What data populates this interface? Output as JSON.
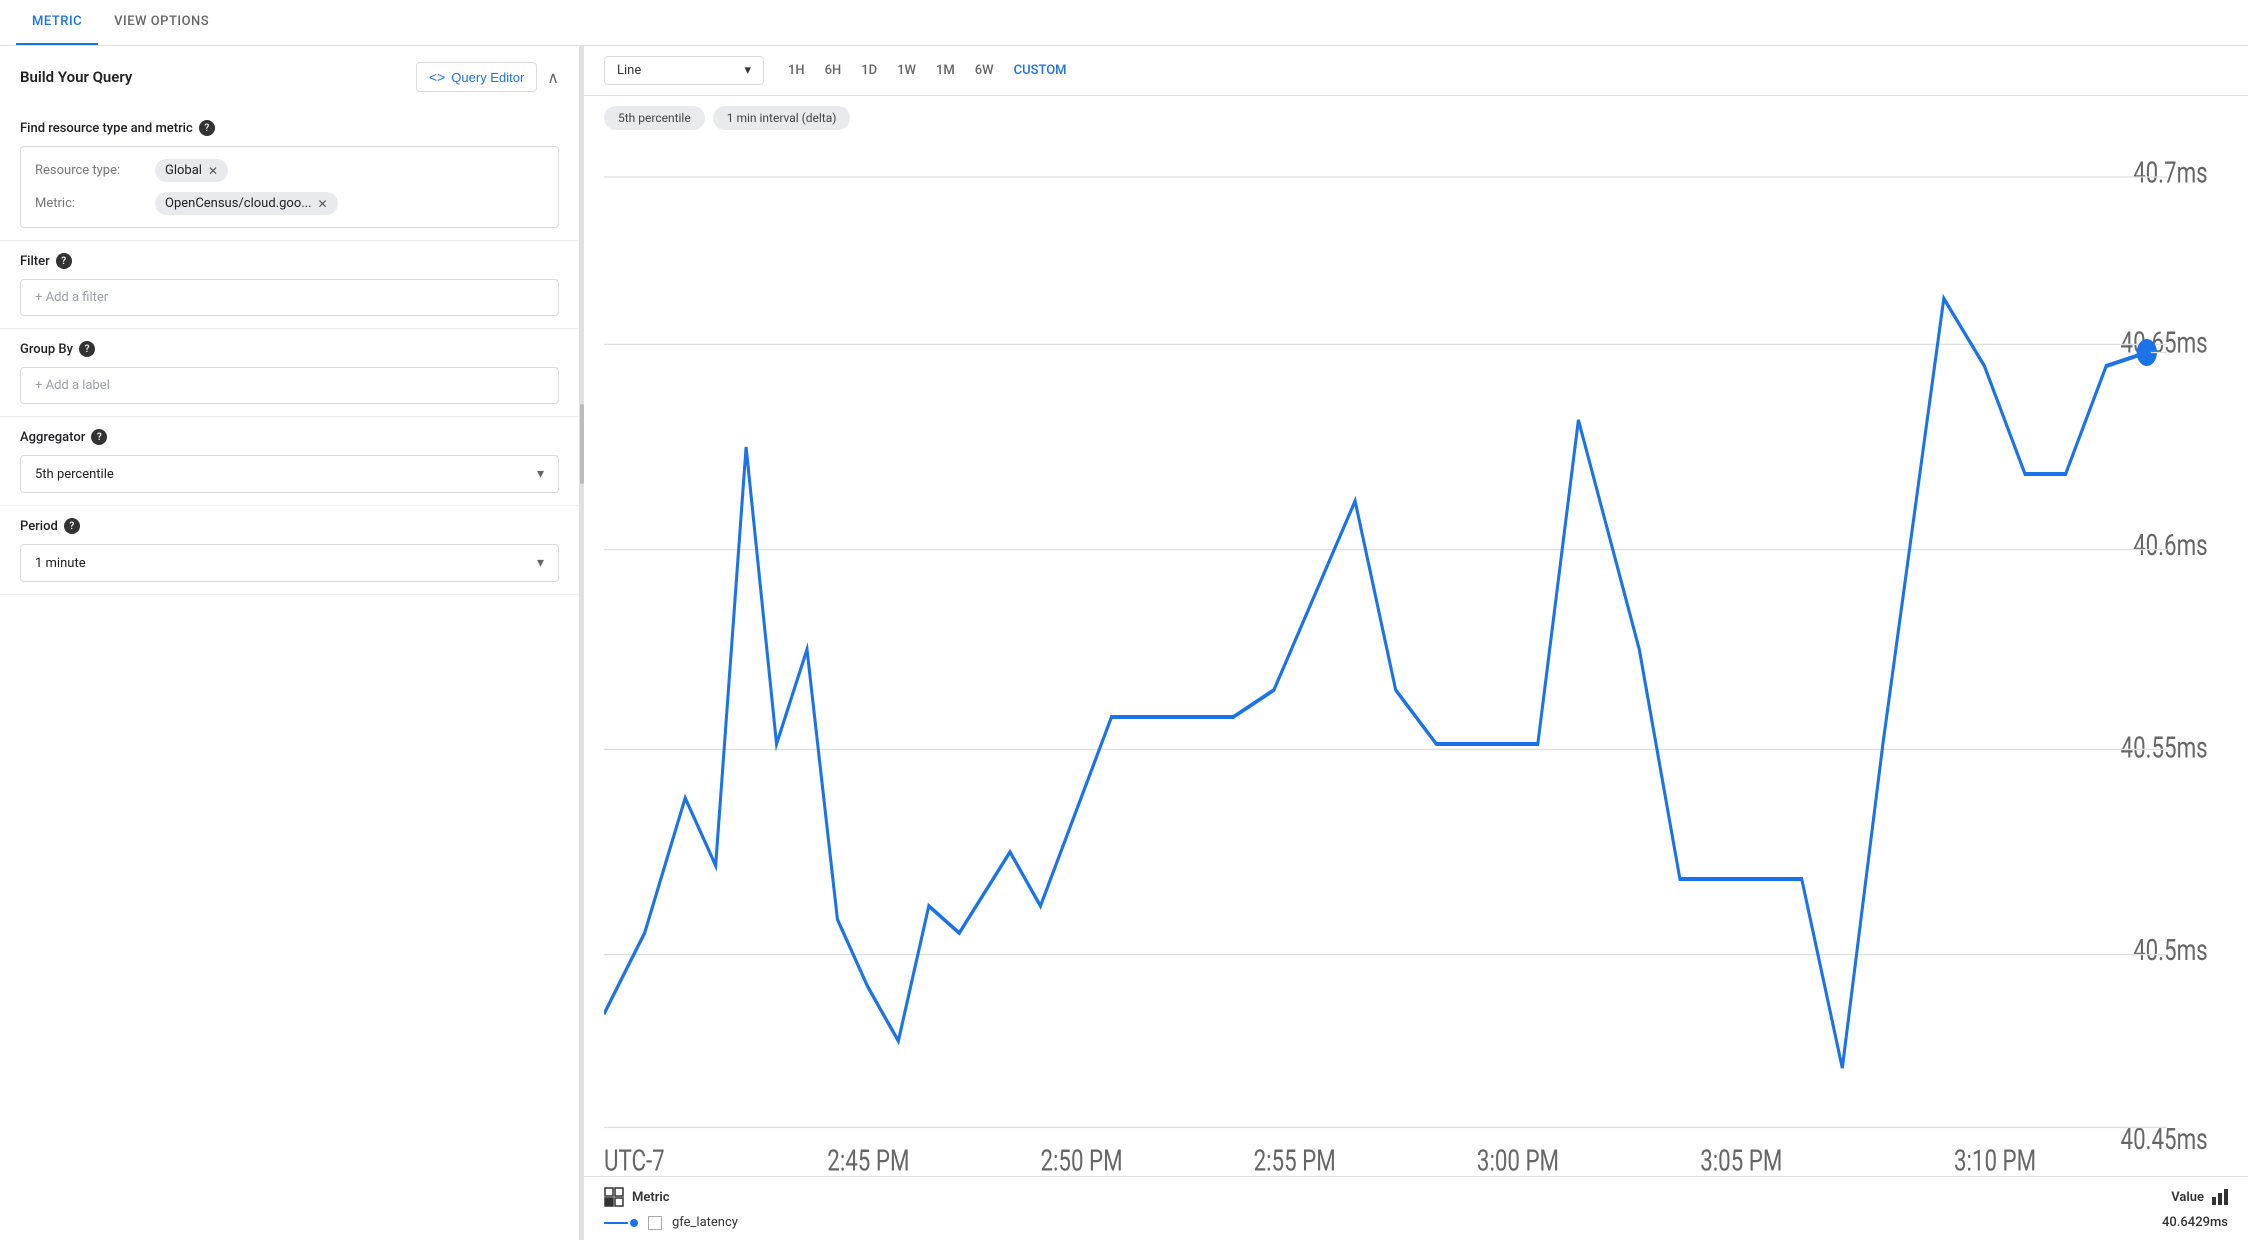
{
  "tabs": [
    {
      "id": "metric",
      "label": "METRIC",
      "active": true
    },
    {
      "id": "view-options",
      "label": "VIEW OPTIONS",
      "active": false
    }
  ],
  "left": {
    "query_section": {
      "title": "Build Your Query",
      "editor_btn": "Query Editor",
      "collapse": "^"
    },
    "find_resource": {
      "label": "Find resource type and metric",
      "has_help": true,
      "resource_type_label": "Resource type:",
      "resource_chip": "Global",
      "metric_label": "Metric:",
      "metric_chip": "OpenCensus/cloud.goo..."
    },
    "filter": {
      "label": "Filter",
      "has_help": true,
      "placeholder": "+ Add a filter"
    },
    "group_by": {
      "label": "Group By",
      "has_help": true,
      "placeholder": "+ Add a label"
    },
    "aggregator": {
      "label": "Aggregator",
      "has_help": true,
      "value": "5th percentile"
    },
    "period": {
      "label": "Period",
      "has_help": true,
      "value": "1 minute"
    }
  },
  "right": {
    "chart_type": "Line",
    "time_options": [
      {
        "label": "1H",
        "active": false
      },
      {
        "label": "6H",
        "active": false
      },
      {
        "label": "1D",
        "active": false
      },
      {
        "label": "1W",
        "active": false
      },
      {
        "label": "1M",
        "active": false
      },
      {
        "label": "6W",
        "active": false
      },
      {
        "label": "CUSTOM",
        "active": true
      }
    ],
    "filter_chips": [
      "5th percentile",
      "1 min interval (delta)"
    ],
    "y_axis": {
      "max": "40.7ms",
      "mid1": "40.65ms",
      "mid2": "40.6ms",
      "mid3": "40.55ms",
      "mid4": "40.5ms",
      "min": "40.45ms"
    },
    "x_axis": {
      "labels": [
        "UTC-7",
        "2:45 PM",
        "2:50 PM",
        "2:55 PM",
        "3:00 PM",
        "3:05 PM",
        "3:10 PM"
      ]
    },
    "legend": {
      "metric_col": "Metric",
      "value_col": "Value",
      "rows": [
        {
          "name": "gfe_latency",
          "value": "40.6429ms"
        }
      ]
    }
  }
}
